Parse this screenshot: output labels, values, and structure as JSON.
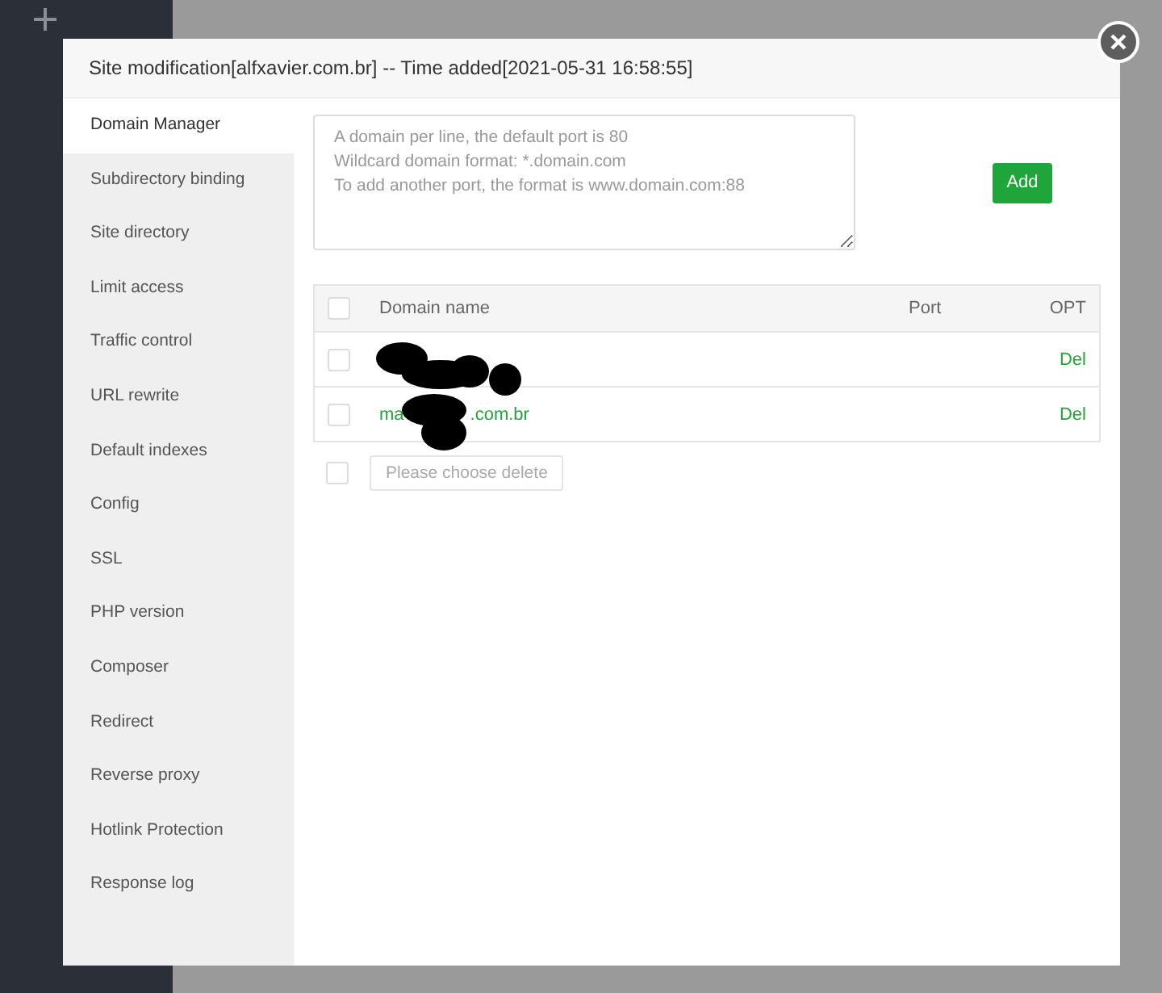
{
  "dialog": {
    "title": "Site modification[alfxavier.com.br] -- Time added[2021-05-31 16:58:55]"
  },
  "menu": [
    {
      "label": "Domain Manager",
      "selected": true
    },
    {
      "label": "Subdirectory binding",
      "selected": false
    },
    {
      "label": "Site directory",
      "selected": false
    },
    {
      "label": "Limit access",
      "selected": false
    },
    {
      "label": "Traffic control",
      "selected": false
    },
    {
      "label": "URL rewrite",
      "selected": false
    },
    {
      "label": "Default indexes",
      "selected": false
    },
    {
      "label": "Config",
      "selected": false
    },
    {
      "label": "SSL",
      "selected": false
    },
    {
      "label": "PHP version",
      "selected": false
    },
    {
      "label": "Composer",
      "selected": false
    },
    {
      "label": "Redirect",
      "selected": false
    },
    {
      "label": "Reverse proxy",
      "selected": false
    },
    {
      "label": "Hotlink Protection",
      "selected": false
    },
    {
      "label": "Response log",
      "selected": false
    }
  ],
  "domain_input": {
    "placeholder": "A domain per line, the default port is 80\nWildcard domain format: *.domain.com\nTo add another port, the format is www.domain.com:88"
  },
  "add_button": "Add",
  "table": {
    "select_all_checked": false,
    "columns": [
      "Domain name",
      "Port",
      "OPT"
    ],
    "rows": [
      {
        "checked": false,
        "domain_parts": [],
        "port": "",
        "action": "Del"
      },
      {
        "checked": false,
        "domain_parts": [
          "ma",
          ".com.br"
        ],
        "port": "",
        "action": "Del"
      }
    ]
  },
  "delete_select": {
    "checked": false,
    "placeholder": "Please choose delete"
  }
}
